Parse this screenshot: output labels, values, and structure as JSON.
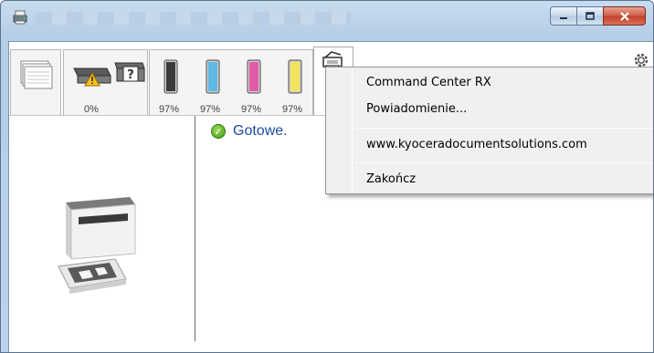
{
  "window": {
    "app_icon": "printer-status-icon",
    "buttons": {
      "minimize": "minimize-icon",
      "maximize": "maximize-icon",
      "close": "close-icon"
    }
  },
  "toolbar": {
    "paper_tab": {
      "icon": "paper-stack-icon"
    },
    "tray_tab": {
      "icon": "paper-tray-warning-icon",
      "unknown_icon": "unknown-cassette-icon",
      "level": "0%"
    },
    "toner_tab": {
      "items": [
        {
          "color": "black",
          "hex": "#3a3a3a",
          "level": "97%"
        },
        {
          "color": "cyan",
          "hex": "#5fb8e6",
          "level": "97%"
        },
        {
          "color": "magenta",
          "hex": "#e35aa8",
          "level": "97%"
        },
        {
          "color": "yellow",
          "hex": "#f3e35a",
          "level": "97%"
        }
      ]
    },
    "tools_tab": {
      "icon": "printer-tools-icon"
    },
    "settings_icon": "gear-icon"
  },
  "status": {
    "icon": "checkmark-icon",
    "text": "Gotowe."
  },
  "printer_image": "printer-icon",
  "context_menu": {
    "items": [
      "Command Center RX",
      "Powiadomienie...",
      "www.kyoceradocumentsolutions.com",
      "Zakończ"
    ]
  },
  "colors": {
    "status_text": "#1f4aa0",
    "close_button": "#c2402b"
  }
}
